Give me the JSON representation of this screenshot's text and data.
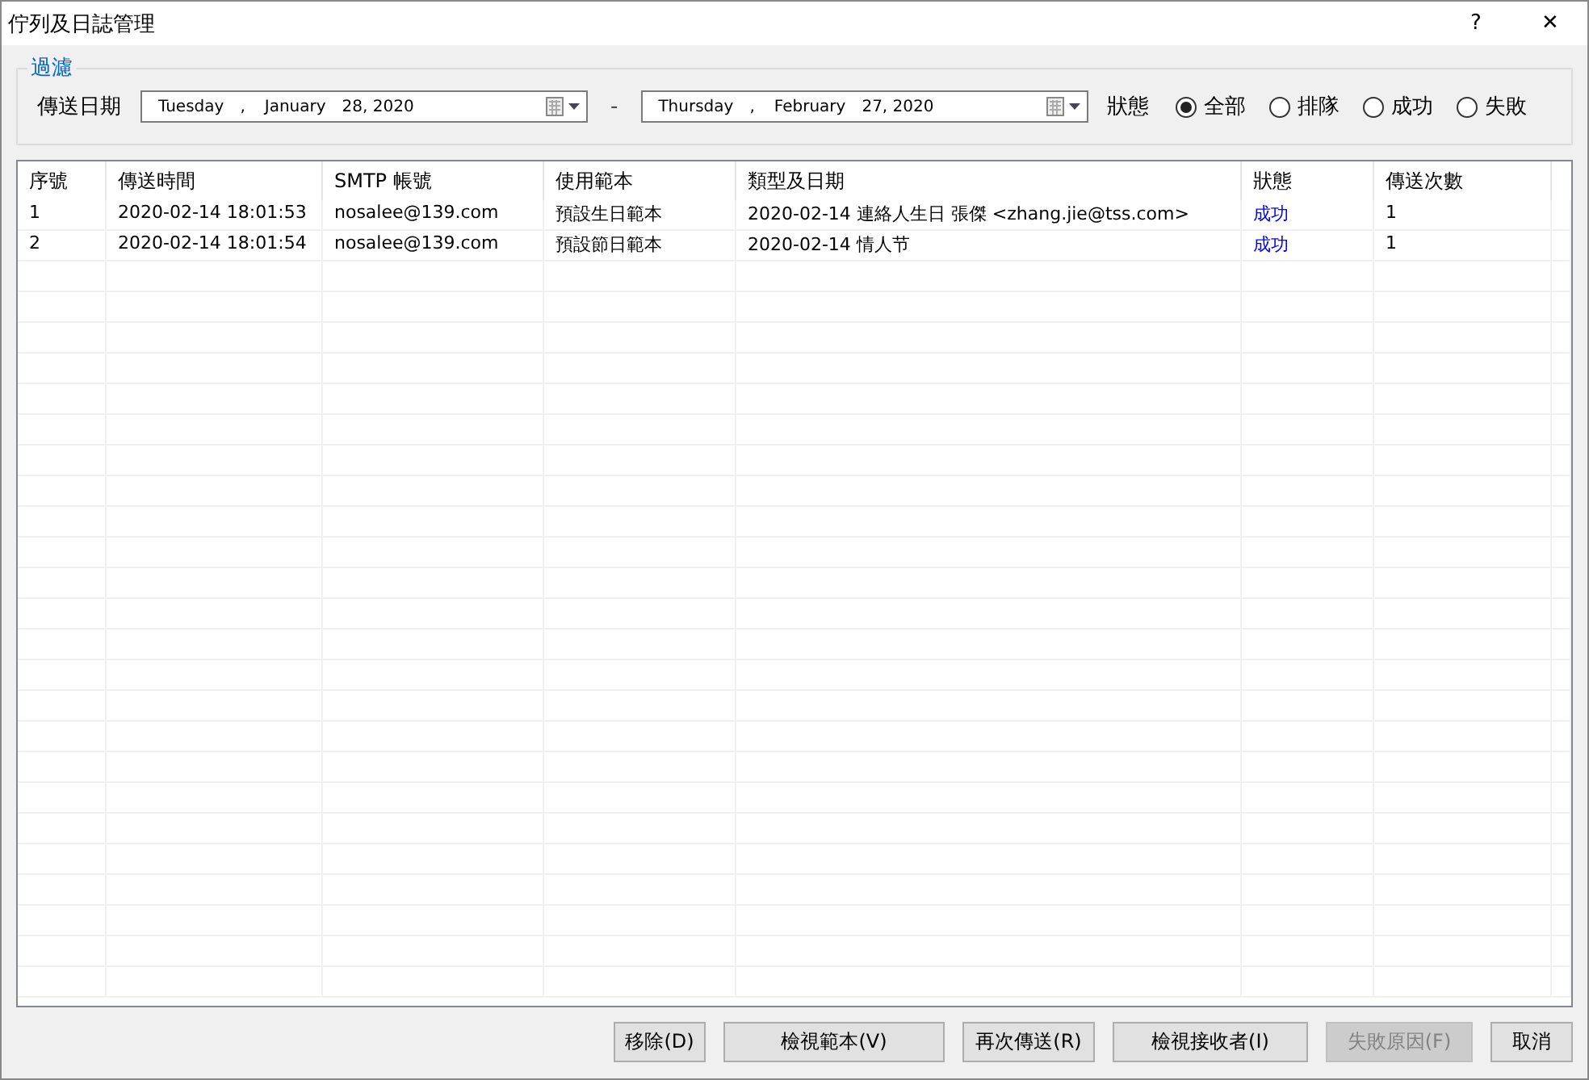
{
  "window": {
    "title": "佇列及日誌管理",
    "help": "?",
    "close": "✕"
  },
  "filter": {
    "title": "過濾",
    "date_label": "傳送日期",
    "from_date": {
      "weekday": "Tuesday",
      "sep": ",",
      "month": "January",
      "day": "28, 2020"
    },
    "dash": "-",
    "to_date": {
      "weekday": "Thursday",
      "sep": ",",
      "month": "February",
      "day": "27, 2020"
    },
    "status_label": "狀態",
    "options": [
      {
        "label": "全部",
        "selected": true
      },
      {
        "label": "排隊",
        "selected": false
      },
      {
        "label": "成功",
        "selected": false
      },
      {
        "label": "失敗",
        "selected": false
      }
    ]
  },
  "table": {
    "columns": [
      "序號",
      "傳送時間",
      "SMTP 帳號",
      "使用範本",
      "類型及日期",
      "狀態",
      "傳送次數"
    ],
    "rows": [
      {
        "cells": [
          "1",
          "2020-02-14 18:01:53",
          "nosalee@139.com",
          "預設生日範本",
          "2020-02-14 連絡人生日 張傑 <zhang.jie@tss.com>",
          "成功",
          "1"
        ],
        "color": "#0000ff",
        "selected": false
      },
      {
        "cells": [
          "2",
          "2020-02-14 18:01:54",
          "nosalee@139.com",
          "預設節日範本",
          "2020-02-14 情人节",
          "成功",
          "1"
        ],
        "color": "#0000ff",
        "selected": false
      }
    ]
  },
  "buttons": [
    {
      "label": "移除(D)",
      "disabled": false
    },
    {
      "label": "檢視範本(V)",
      "disabled": false
    },
    {
      "label": "再次傳送(R)",
      "disabled": false
    },
    {
      "label": "檢視接收者(I)",
      "disabled": false
    },
    {
      "label": "失敗原因(F)",
      "disabled": true
    },
    {
      "label": "取消",
      "disabled": false
    }
  ]
}
